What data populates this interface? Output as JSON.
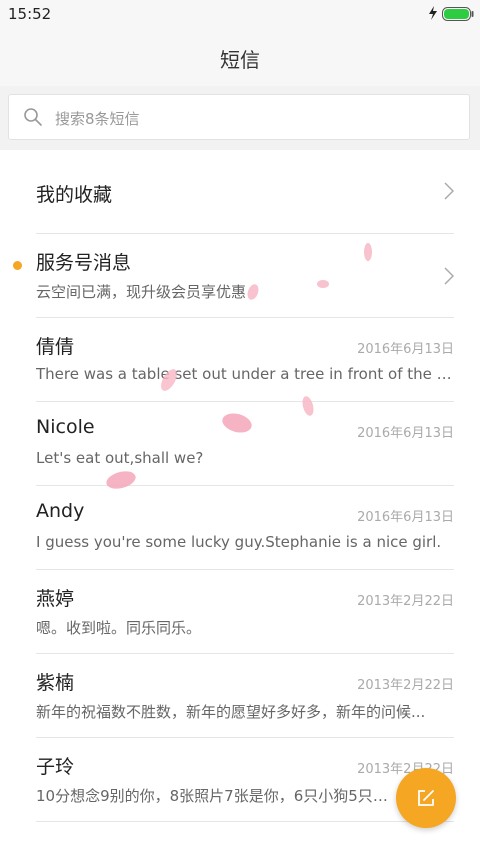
{
  "status_bar": {
    "time": "15:52"
  },
  "header": {
    "title": "短信"
  },
  "search": {
    "placeholder": "搜索8条短信"
  },
  "colors": {
    "accent": "#f5a623",
    "battery": "#2ecc40"
  },
  "favorites": {
    "label": "我的收藏"
  },
  "service": {
    "name": "服务号消息",
    "preview": "云空间已满，现升级会员享优惠"
  },
  "messages": [
    {
      "name": "倩倩",
      "date": "2016年6月13日",
      "preview": "There was a table set out under a tree in front of the ho..."
    },
    {
      "name": "Nicole",
      "date": "2016年6月13日",
      "preview": "Let's eat out,shall we?"
    },
    {
      "name": "Andy",
      "date": "2016年6月13日",
      "preview": "I guess you're some lucky guy.Stephanie is a nice girl."
    },
    {
      "name": "燕婷",
      "date": "2013年2月22日",
      "preview": "嗯。收到啦。同乐同乐。"
    },
    {
      "name": "紫楠",
      "date": "2013年2月22日",
      "preview": "新年的祝福数不胜数，新年的愿望好多好多，新年的问候..."
    },
    {
      "name": "子玲",
      "date": "2013年2月22日",
      "preview": "10分想念9别的你，8张照片7张是你，6只小狗5只像你..."
    }
  ],
  "icons": {
    "search": "search-icon",
    "chevron": "chevron-right-icon",
    "compose": "compose-icon",
    "bolt": "charging-icon",
    "battery": "battery-icon"
  }
}
